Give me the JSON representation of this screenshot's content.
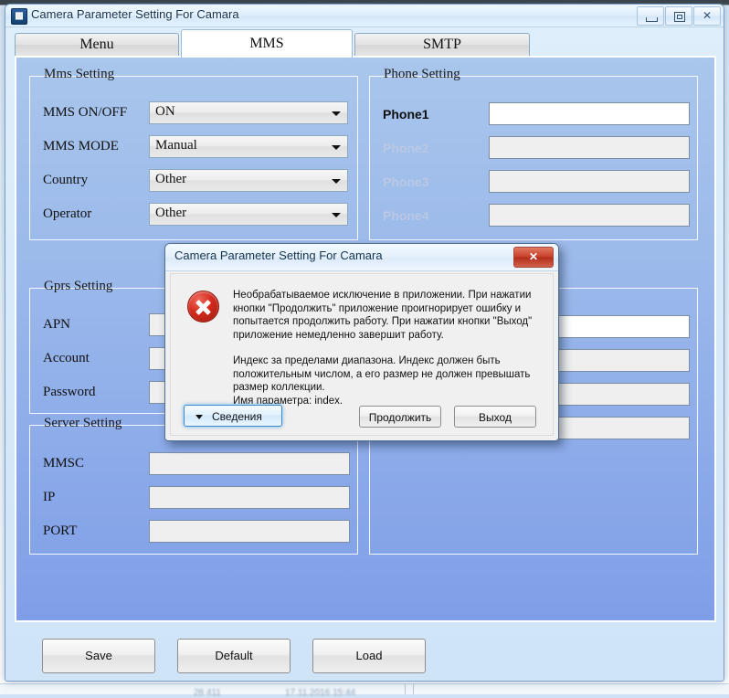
{
  "window": {
    "title": "Camera Parameter Setting For  Camara",
    "icon": "app-icon",
    "minimize_label": "—",
    "maximize_label": "□",
    "close_label": "✕"
  },
  "tabs": [
    {
      "label": "Menu",
      "active": false
    },
    {
      "label": "MMS",
      "active": true
    },
    {
      "label": "SMTP",
      "active": false
    }
  ],
  "mms_setting": {
    "group_label": "Mms Setting",
    "rows": [
      {
        "label": "MMS ON/OFF",
        "value": "ON"
      },
      {
        "label": "MMS MODE",
        "value": "Manual"
      },
      {
        "label": "Country",
        "value": "Other"
      },
      {
        "label": "Operator",
        "value": "Other"
      }
    ]
  },
  "phone_setting": {
    "group_label": "Phone Setting",
    "rows": [
      {
        "label": "Phone1",
        "value": "",
        "enabled": true
      },
      {
        "label": "Phone2",
        "value": "",
        "enabled": false
      },
      {
        "label": "Phone3",
        "value": "",
        "enabled": false
      },
      {
        "label": "Phone4",
        "value": "",
        "enabled": false
      }
    ]
  },
  "gprs_setting": {
    "group_label": "Gprs Setting",
    "rows": [
      {
        "label": "APN",
        "value": ""
      },
      {
        "label": "Account",
        "value": ""
      },
      {
        "label": "Password",
        "value": ""
      }
    ]
  },
  "server_setting": {
    "group_label": "Server Setting",
    "rows": [
      {
        "label": "MMSC",
        "value": ""
      },
      {
        "label": "IP",
        "value": ""
      },
      {
        "label": "PORT",
        "value": ""
      }
    ]
  },
  "right_lower_group": {
    "rows": [
      {
        "value": "",
        "enabled": true
      },
      {
        "value": "",
        "enabled": false
      },
      {
        "value": "",
        "enabled": false
      },
      {
        "value": "",
        "enabled": false
      }
    ]
  },
  "footer_buttons": [
    {
      "label": "Save"
    },
    {
      "label": "Default"
    },
    {
      "label": "Load"
    }
  ],
  "error_dialog": {
    "title": "Camera Parameter Setting For  Camara",
    "close_label": "✕",
    "icon": "error-circle-x-icon",
    "message_main": "Необрабатываемое исключение в приложении. При нажатии кнопки \"Продолжить\" приложение проигнорирует ошибку и попытается продолжить работу. При нажатии кнопки \"Выход\" приложение немедленно завершит работу.",
    "message_detail": "Индекс за пределами диапазона. Индекс должен быть положительным числом, а его размер не должен превышать размер коллекции.\nИмя параметра: index.",
    "buttons": {
      "details": "Сведения",
      "continue": "Продолжить",
      "exit": "Выход"
    }
  },
  "background": {
    "status_left": "28 411",
    "status_right": "17.11.2016 15:44"
  },
  "colors": {
    "form_blue_top": "#a9c6ec",
    "form_blue_bottom": "#7f9ee8",
    "accent_red": "#c9402a",
    "focus_blue": "#3c87c8"
  }
}
